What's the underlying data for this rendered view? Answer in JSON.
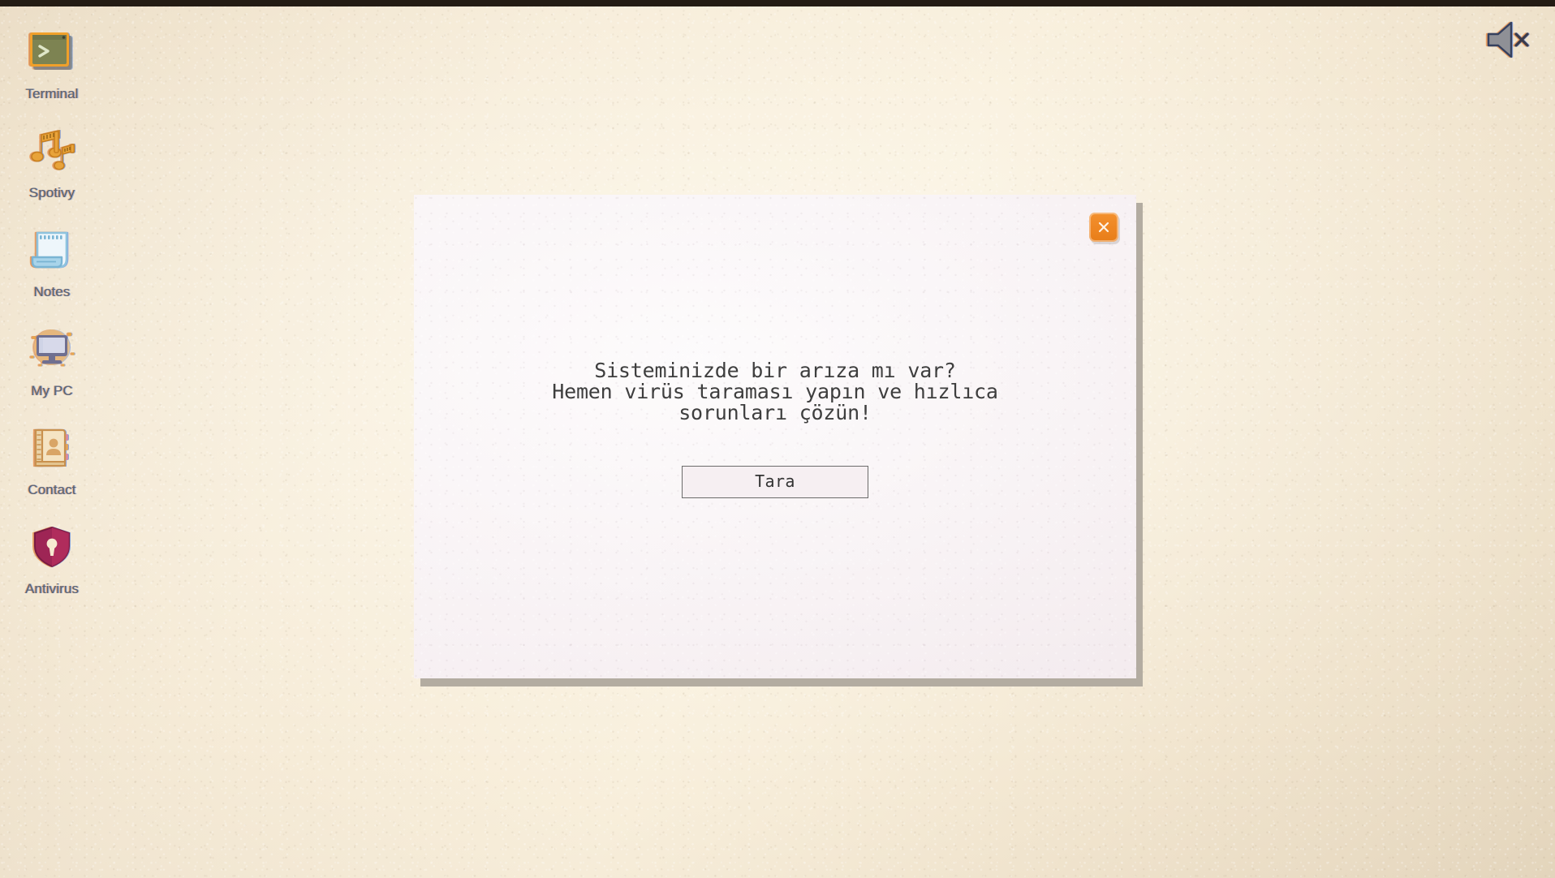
{
  "desktop": {
    "background_color": "#eee0c8",
    "icons": [
      {
        "label": "Terminal",
        "icon": "terminal-icon"
      },
      {
        "label": "Spotivy",
        "icon": "music-notes-icon"
      },
      {
        "label": "Notes",
        "icon": "notepad-icon"
      },
      {
        "label": "My PC",
        "icon": "desktop-computer-icon"
      },
      {
        "label": "Contact",
        "icon": "address-book-icon"
      },
      {
        "label": "Antivirus",
        "icon": "shield-keyhole-icon"
      }
    ]
  },
  "tray": {
    "mute_icon": "speaker-muted-icon"
  },
  "dialog": {
    "background_color": "#f6eff2",
    "message": "Sisteminizde bir arıza mı var?\nHemen virüs taraması yapın ve hızlıca\nsorunları çözün!",
    "scan_button_label": "Tara",
    "close_icon": "close-x-icon",
    "close_button_color": "#ee8622"
  }
}
